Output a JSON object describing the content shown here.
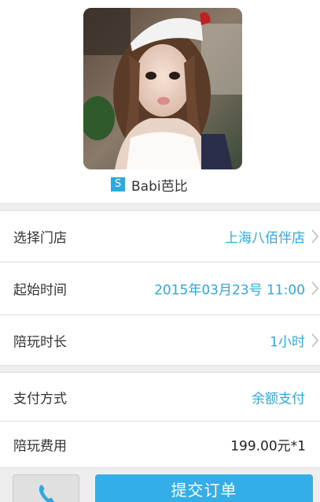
{
  "profile": {
    "nickname_badge": "S",
    "nickname": "Babi芭比"
  },
  "order": {
    "store": {
      "label": "选择门店",
      "value": "上海八佰伴店"
    },
    "start_time": {
      "label": "起始时间",
      "value": "2015年03月23号 11:00"
    },
    "duration": {
      "label": "陪玩时长",
      "value": "1小时"
    },
    "payment": {
      "label": "支付方式",
      "value": "余额支付"
    },
    "fee": {
      "label": "陪玩费用",
      "value": "199.00元*1"
    }
  },
  "bottom_bar": {
    "submit_label": "提交订单",
    "call_icon": "phone-icon"
  },
  "colors": {
    "accent": "#2fa9dc",
    "submit_bg": "#33aee6"
  }
}
